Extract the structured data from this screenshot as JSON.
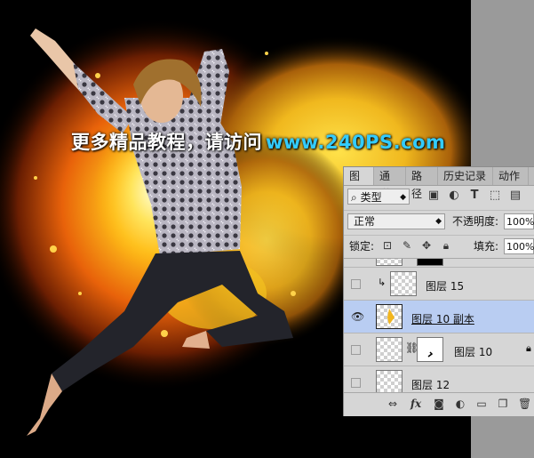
{
  "canvas": {
    "watermark_text": "更多精品教程，请访问",
    "watermark_url": "www.240PS.com"
  },
  "layers_panel": {
    "tabs": [
      "图层",
      "通道",
      "路径",
      "历史记录",
      "动作"
    ],
    "active_tab": "图层",
    "filter_kind": "类型",
    "filter_icons": [
      "image-filter-icon",
      "adjustment-filter-icon",
      "type-filter-icon",
      "shape-filter-icon",
      "smart-object-filter-icon"
    ],
    "blend_mode": "正常",
    "opacity_label": "不透明度:",
    "opacity_value": "100%",
    "lock_label": "锁定:",
    "fill_label": "填充:",
    "fill_value": "100%",
    "layers": [
      {
        "name": "图层 15",
        "visible": false,
        "clipped": true,
        "selected": false
      },
      {
        "name": "图层 10 副本",
        "visible": true,
        "clipped": false,
        "selected": true
      },
      {
        "name": "图层 10",
        "visible": false,
        "clipped": false,
        "selected": false,
        "has_mask": true
      },
      {
        "name": "图层 12",
        "visible": false,
        "clipped": false,
        "selected": false
      }
    ],
    "bottom_icons": [
      "link-layers-icon",
      "fx-icon",
      "add-mask-icon",
      "new-adjustment-icon",
      "new-group-icon",
      "new-layer-icon",
      "delete-layer-icon"
    ],
    "colors": {
      "selected_row": "#b9cdf2",
      "panel_bg": "#d6d6d6",
      "watermark_url": "#33ccff"
    }
  }
}
